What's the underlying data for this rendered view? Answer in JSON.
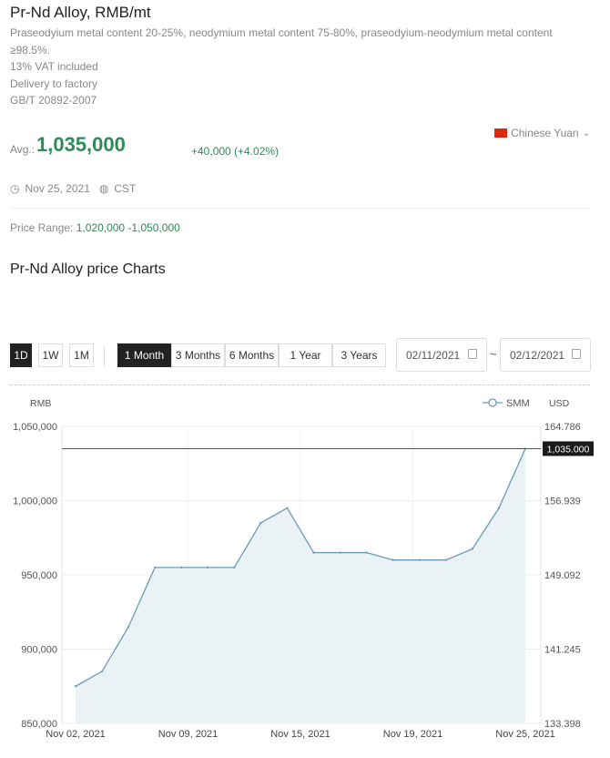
{
  "header": {
    "title": "Pr-Nd Alloy, RMB/mt",
    "desc_lines": [
      "Praseodyium metal content 20-25%, neodymium metal content 75-80%, praseodyium-neodymium metal content",
      "≥98.5%.",
      "13% VAT included",
      "Delivery to factory",
      "GB/T 20892-2007"
    ]
  },
  "price": {
    "avg_label": "Avg.:",
    "avg_value": "1,035,000",
    "change": "+40,000 (+4.02%)",
    "currency": "Chinese Yuan",
    "date": "Nov 25, 2021",
    "tz": "CST",
    "range_label": "Price Range:",
    "range_value": "1,020,000 -1,050,000"
  },
  "charts_title": "Pr-Nd Alloy price Charts",
  "controls": {
    "ranges": [
      "1D",
      "1W",
      "1M"
    ],
    "periods": [
      "1 Month",
      "3 Months",
      "6 Months",
      "1 Year",
      "3 Years"
    ],
    "active_range": "1D",
    "active_period": "1 Month",
    "date_from": "02/11/2021",
    "date_to": "02/12/2021",
    "tilde": "~"
  },
  "colors": {
    "accent_green": "#2e8b57",
    "line": "#6a9bb8",
    "area": "#eaf2f6"
  },
  "chart_data": {
    "type": "area",
    "ylabel": "RMB",
    "y2label": "USD",
    "legend": "SMM",
    "legend_position": "top-right",
    "ylim": [
      850000,
      1050000
    ],
    "y_ticks": [
      "1,050,000",
      "1,000,000",
      "950,000",
      "900,000",
      "850,000"
    ],
    "y2_ticks": [
      "164.786",
      "156.939",
      "149.092",
      "141.245",
      "133.398"
    ],
    "x_ticks": [
      "Nov 02, 2021",
      "Nov 09, 2021",
      "Nov 15, 2021",
      "Nov 19, 2021",
      "Nov 25, 2021"
    ],
    "x": [
      "Nov 02",
      "Nov 03",
      "Nov 04",
      "Nov 05",
      "Nov 08",
      "Nov 09",
      "Nov 10",
      "Nov 11",
      "Nov 12",
      "Nov 15",
      "Nov 16",
      "Nov 17",
      "Nov 18",
      "Nov 19",
      "Nov 22",
      "Nov 23",
      "Nov 24",
      "Nov 25"
    ],
    "values": [
      875000,
      885000,
      915000,
      955000,
      955000,
      955000,
      955000,
      985000,
      995000,
      965000,
      965000,
      965000,
      960000,
      960000,
      960000,
      967500,
      995000,
      1035000
    ],
    "last_value_label": "1,035.000",
    "grid": true
  }
}
